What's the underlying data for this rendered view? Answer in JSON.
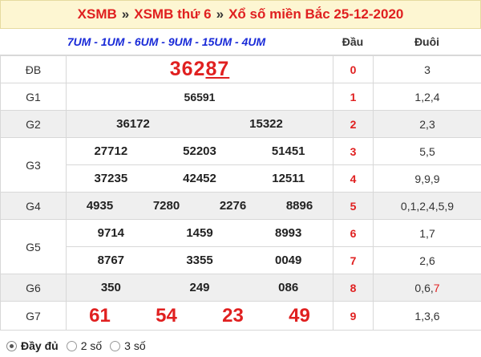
{
  "title": {
    "crumb1": "XSMB",
    "sep1": "»",
    "crumb2": "XSMB thứ 6",
    "sep2": "»",
    "crumb3": "Xổ số miền Bắc 25-12-2020"
  },
  "header": {
    "names": "7UM - 1UM - 6UM - 9UM - 15UM - 4UM",
    "dau": "Đầu",
    "duoi": "Đuôi"
  },
  "prizes": {
    "db": {
      "label": "ĐB",
      "prefix": "362",
      "suffix": "87"
    },
    "g1": {
      "label": "G1",
      "values": [
        "56591"
      ]
    },
    "g2": {
      "label": "G2",
      "values": [
        "36172",
        "15322"
      ]
    },
    "g3": {
      "label": "G3",
      "values": [
        "27712",
        "52203",
        "51451",
        "37235",
        "42452",
        "12511"
      ]
    },
    "g4": {
      "label": "G4",
      "values": [
        "4935",
        "7280",
        "2276",
        "8896"
      ]
    },
    "g5": {
      "label": "G5",
      "values": [
        "9714",
        "1459",
        "8993",
        "8767",
        "3355",
        "0049"
      ]
    },
    "g6": {
      "label": "G6",
      "values": [
        "350",
        "249",
        "086"
      ]
    },
    "g7": {
      "label": "G7",
      "values": [
        "61",
        "54",
        "23",
        "49"
      ]
    }
  },
  "loto": [
    {
      "dau": "0",
      "duoi": "3"
    },
    {
      "dau": "1",
      "duoi": "1,2,4"
    },
    {
      "dau": "2",
      "duoi": "2,3"
    },
    {
      "dau": "3",
      "duoi": "5,5"
    },
    {
      "dau": "4",
      "duoi": "9,9,9"
    },
    {
      "dau": "5",
      "duoi": "0,1,2,4,5,9"
    },
    {
      "dau": "6",
      "duoi": "1,7"
    },
    {
      "dau": "7",
      "duoi": "2,6"
    },
    {
      "dau": "8",
      "duoi_prefix": "0,6,",
      "duoi_red": "7"
    },
    {
      "dau": "9",
      "duoi": "1,3,6"
    }
  ],
  "footer": {
    "opt_full": "Đầy đủ",
    "opt_2": "2 số",
    "opt_3": "3 số",
    "selected": "Đầy đủ"
  },
  "colors": {
    "accent_red": "#e02020",
    "header_blue": "#1a2bd8",
    "title_bg": "#fdf6d2",
    "row_gray": "#efefef"
  }
}
